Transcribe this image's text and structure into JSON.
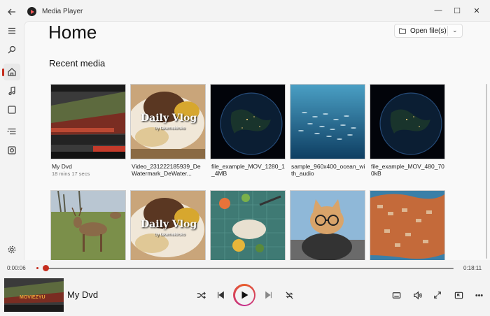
{
  "window": {
    "title": "Media Player",
    "controls": {
      "minimize": "—",
      "maximize": "☐",
      "close": "✕"
    }
  },
  "sidebar": {
    "items": [
      {
        "name": "back-icon"
      },
      {
        "name": "menu-icon"
      },
      {
        "name": "search-icon"
      },
      {
        "name": "home-icon",
        "active": true
      },
      {
        "name": "music-icon"
      },
      {
        "name": "video-icon"
      },
      {
        "name": "playlist-icon"
      },
      {
        "name": "playqueue-icon"
      },
      {
        "name": "settings-icon"
      }
    ]
  },
  "main": {
    "page_title": "Home",
    "open_button": {
      "label": "Open file(s)",
      "chevron": "⌄"
    },
    "section_title": "Recent media",
    "recent": [
      {
        "title": "My Dvd",
        "subtitle": "18 mins 17 secs",
        "thumb": "dvd"
      },
      {
        "title": "Video_231222185939_DeWatermark_DeWater...",
        "subtitle": "",
        "thumb": "vlog"
      },
      {
        "title": "file_example_MOV_1280_1_4MB",
        "subtitle": "",
        "thumb": "earth"
      },
      {
        "title": "sample_960x400_ocean_with_audio",
        "subtitle": "",
        "thumb": "ocean"
      },
      {
        "title": "file_example_MOV_480_700kB",
        "subtitle": "",
        "thumb": "earth"
      },
      {
        "title": "",
        "subtitle": "",
        "thumb": "deer"
      },
      {
        "title": "",
        "subtitle": "",
        "thumb": "vlog"
      },
      {
        "title": "",
        "subtitle": "",
        "thumb": "craft"
      },
      {
        "title": "",
        "subtitle": "",
        "thumb": "cat"
      },
      {
        "title": "",
        "subtitle": "",
        "thumb": "city"
      }
    ],
    "vlog_text": {
      "main": "Daily Vlog",
      "sub": "by takemekiroko"
    }
  },
  "player": {
    "elapsed": "0:00:06",
    "total": "0:18:11",
    "progress": 0.006,
    "now_playing_title": "My Dvd",
    "now_playing_thumb_text": "MOVIEZYU",
    "accent": "#c42b1c"
  }
}
